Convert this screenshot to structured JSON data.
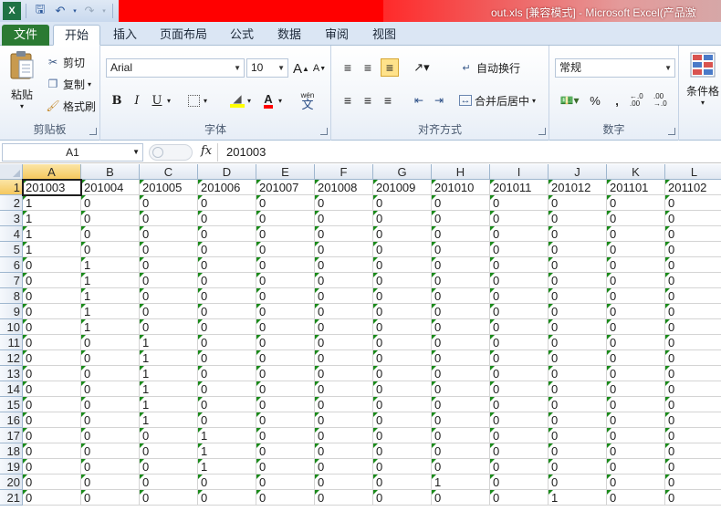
{
  "window": {
    "title": "out.xls  [兼容模式]  -  Microsoft Excel(产品激"
  },
  "qat": {
    "save_icon": "save-icon",
    "undo_icon": "undo-icon",
    "redo_icon": "redo-icon"
  },
  "tabs": [
    "文件",
    "开始",
    "插入",
    "页面布局",
    "公式",
    "数据",
    "审阅",
    "视图"
  ],
  "ribbon": {
    "clipboard": {
      "paste": "粘贴",
      "cut": "剪切",
      "copy": "复制",
      "format_painter": "格式刷",
      "label": "剪贴板"
    },
    "font": {
      "name": "Arial",
      "size": "10",
      "grow": "A",
      "shrink": "A",
      "bold": "B",
      "italic": "I",
      "underline": "U",
      "font_color": "A",
      "phonetic": "wén",
      "label": "字体"
    },
    "alignment": {
      "wrap_text": "自动换行",
      "merge_center": "合并后居中",
      "label": "对齐方式"
    },
    "number": {
      "format": "常规",
      "percent": "%",
      "comma": ",",
      "inc_decimal": "←.0 .00",
      "dec_decimal": ".00 →.0",
      "label": "数字"
    },
    "styles": {
      "conditional_format": "条件格"
    }
  },
  "formula_bar": {
    "name_box": "A1",
    "fx": "fx",
    "value": "201003"
  },
  "sheet": {
    "columns": [
      "A",
      "B",
      "C",
      "D",
      "E",
      "F",
      "G",
      "H",
      "I",
      "J",
      "K",
      "L"
    ],
    "header_row": [
      "201003",
      "201004",
      "201005",
      "201006",
      "201007",
      "201008",
      "201009",
      "201010",
      "201011",
      "201012",
      "201101",
      "201102"
    ],
    "rows": [
      [
        "1",
        "0",
        "0",
        "0",
        "0",
        "0",
        "0",
        "0",
        "0",
        "0",
        "0",
        "0"
      ],
      [
        "1",
        "0",
        "0",
        "0",
        "0",
        "0",
        "0",
        "0",
        "0",
        "0",
        "0",
        "0"
      ],
      [
        "1",
        "0",
        "0",
        "0",
        "0",
        "0",
        "0",
        "0",
        "0",
        "0",
        "0",
        "0"
      ],
      [
        "1",
        "0",
        "0",
        "0",
        "0",
        "0",
        "0",
        "0",
        "0",
        "0",
        "0",
        "0"
      ],
      [
        "0",
        "1",
        "0",
        "0",
        "0",
        "0",
        "0",
        "0",
        "0",
        "0",
        "0",
        "0"
      ],
      [
        "0",
        "1",
        "0",
        "0",
        "0",
        "0",
        "0",
        "0",
        "0",
        "0",
        "0",
        "0"
      ],
      [
        "0",
        "1",
        "0",
        "0",
        "0",
        "0",
        "0",
        "0",
        "0",
        "0",
        "0",
        "0"
      ],
      [
        "0",
        "1",
        "0",
        "0",
        "0",
        "0",
        "0",
        "0",
        "0",
        "0",
        "0",
        "0"
      ],
      [
        "0",
        "1",
        "0",
        "0",
        "0",
        "0",
        "0",
        "0",
        "0",
        "0",
        "0",
        "0"
      ],
      [
        "0",
        "0",
        "1",
        "0",
        "0",
        "0",
        "0",
        "0",
        "0",
        "0",
        "0",
        "0"
      ],
      [
        "0",
        "0",
        "1",
        "0",
        "0",
        "0",
        "0",
        "0",
        "0",
        "0",
        "0",
        "0"
      ],
      [
        "0",
        "0",
        "1",
        "0",
        "0",
        "0",
        "0",
        "0",
        "0",
        "0",
        "0",
        "0"
      ],
      [
        "0",
        "0",
        "1",
        "0",
        "0",
        "0",
        "0",
        "0",
        "0",
        "0",
        "0",
        "0"
      ],
      [
        "0",
        "0",
        "1",
        "0",
        "0",
        "0",
        "0",
        "0",
        "0",
        "0",
        "0",
        "0"
      ],
      [
        "0",
        "0",
        "1",
        "0",
        "0",
        "0",
        "0",
        "0",
        "0",
        "0",
        "0",
        "0"
      ],
      [
        "0",
        "0",
        "0",
        "1",
        "0",
        "0",
        "0",
        "0",
        "0",
        "0",
        "0",
        "0"
      ],
      [
        "0",
        "0",
        "0",
        "1",
        "0",
        "0",
        "0",
        "0",
        "0",
        "0",
        "0",
        "0"
      ],
      [
        "0",
        "0",
        "0",
        "1",
        "0",
        "0",
        "0",
        "0",
        "0",
        "0",
        "0",
        "0"
      ],
      [
        "0",
        "0",
        "0",
        "0",
        "0",
        "0",
        "0",
        "1",
        "0",
        "0",
        "0",
        "0"
      ],
      [
        "0",
        "0",
        "0",
        "0",
        "0",
        "0",
        "0",
        "0",
        "0",
        "1",
        "0",
        "0"
      ]
    ]
  },
  "colors": {
    "file_tab": "#2b7a33",
    "title_highlight": "#ff0000",
    "error_triangle": "#1a8a1a",
    "selection_header": "#f5c85e"
  }
}
